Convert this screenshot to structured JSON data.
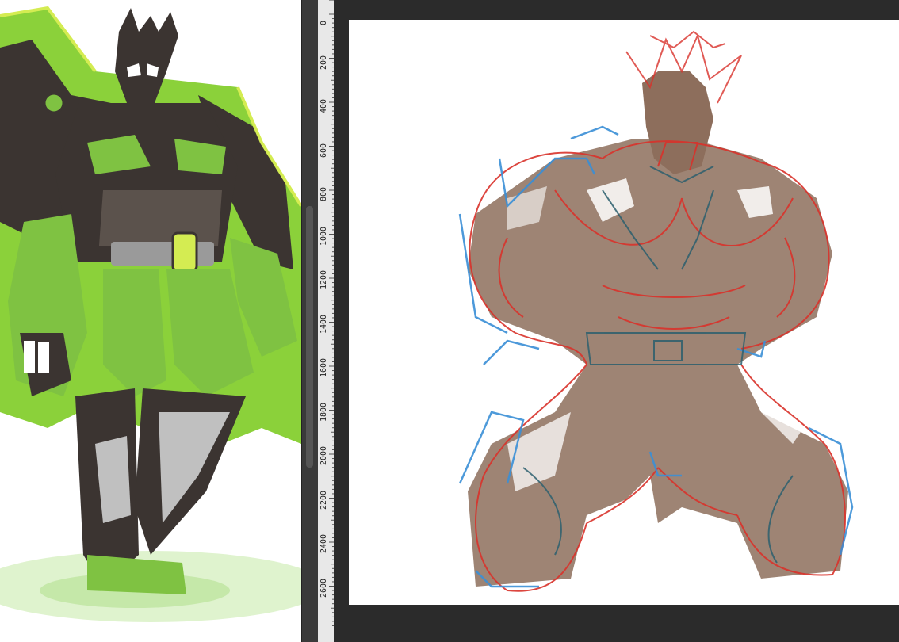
{
  "reference_panel": {
    "title": ""
  },
  "ruler": {
    "ticks": [
      "0",
      "200",
      "400",
      "600",
      "800",
      "1000",
      "1200",
      "1400",
      "1600",
      "1800",
      "2000",
      "2200",
      "2400",
      "2600"
    ]
  },
  "colors": {
    "workspace_bg": "#2b2b2b",
    "ruler_bg": "#e8e8e8",
    "canvas_bg": "#ffffff",
    "sketch_red": "#d9322b",
    "sketch_blue": "#3a8fd6",
    "skin_fill": "#8d6e5c",
    "ref_green": "#8bc34a",
    "ref_dark": "#3b3431"
  }
}
